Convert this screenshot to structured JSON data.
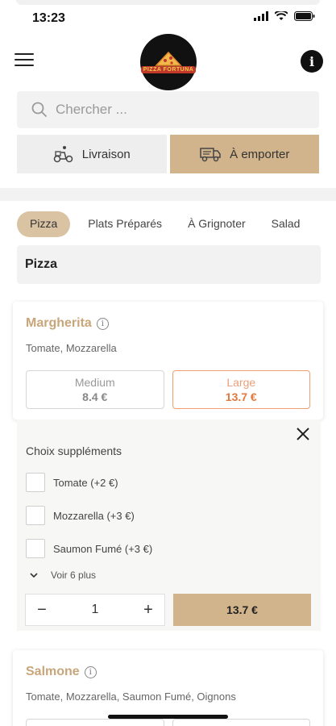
{
  "status": {
    "time": "13:23"
  },
  "header": {
    "logo_text": "PIZZA FORTUNA",
    "info_label": "i"
  },
  "search": {
    "placeholder": "Chercher ..."
  },
  "modes": [
    {
      "label": "Livraison",
      "active": false
    },
    {
      "label": "À emporter",
      "active": true
    }
  ],
  "categories": [
    "Pizza",
    "Plats Préparés",
    "À Grignoter",
    "Salad"
  ],
  "section_title": "Pizza",
  "products": [
    {
      "name": "Margherita",
      "description": "Tomate, Mozzarella",
      "sizes": [
        {
          "label": "Medium",
          "price": "8.4 €"
        },
        {
          "label": "Large",
          "price": "13.7 €",
          "selected": true
        }
      ]
    },
    {
      "name": "Salmone",
      "description": "Tomate, Mozzarella, Saumon Fumé, Oignons"
    }
  ],
  "supplements": {
    "title": "Choix suppléments",
    "options": [
      "Tomate (+2 €)",
      "Mozzarella (+3 €)",
      "Saumon Fumé (+3 €)"
    ],
    "more_label": "Voir 6 plus"
  },
  "cart": {
    "quantity": "1",
    "minus": "−",
    "plus": "+",
    "add_label": "13.7 €"
  },
  "colors": {
    "accent": "#d2b48c",
    "product_name": "#c9a57a",
    "selected_price": "#e2783b"
  }
}
